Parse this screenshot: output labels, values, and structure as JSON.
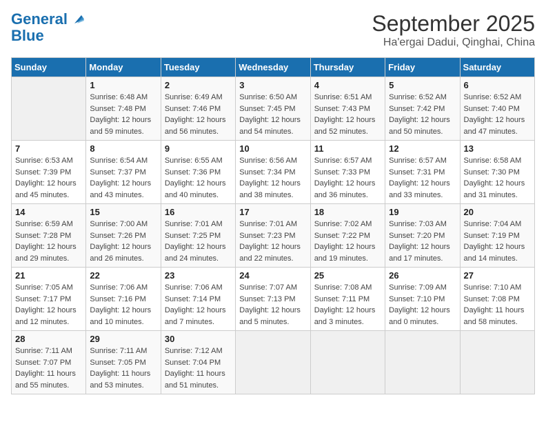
{
  "header": {
    "logo_line1": "General",
    "logo_line2": "Blue",
    "month": "September 2025",
    "location": "Ha'ergai Dadui, Qinghai, China"
  },
  "days_of_week": [
    "Sunday",
    "Monday",
    "Tuesday",
    "Wednesday",
    "Thursday",
    "Friday",
    "Saturday"
  ],
  "weeks": [
    [
      {
        "day": "",
        "info": ""
      },
      {
        "day": "1",
        "info": "Sunrise: 6:48 AM\nSunset: 7:48 PM\nDaylight: 12 hours\nand 59 minutes."
      },
      {
        "day": "2",
        "info": "Sunrise: 6:49 AM\nSunset: 7:46 PM\nDaylight: 12 hours\nand 56 minutes."
      },
      {
        "day": "3",
        "info": "Sunrise: 6:50 AM\nSunset: 7:45 PM\nDaylight: 12 hours\nand 54 minutes."
      },
      {
        "day": "4",
        "info": "Sunrise: 6:51 AM\nSunset: 7:43 PM\nDaylight: 12 hours\nand 52 minutes."
      },
      {
        "day": "5",
        "info": "Sunrise: 6:52 AM\nSunset: 7:42 PM\nDaylight: 12 hours\nand 50 minutes."
      },
      {
        "day": "6",
        "info": "Sunrise: 6:52 AM\nSunset: 7:40 PM\nDaylight: 12 hours\nand 47 minutes."
      }
    ],
    [
      {
        "day": "7",
        "info": "Sunrise: 6:53 AM\nSunset: 7:39 PM\nDaylight: 12 hours\nand 45 minutes."
      },
      {
        "day": "8",
        "info": "Sunrise: 6:54 AM\nSunset: 7:37 PM\nDaylight: 12 hours\nand 43 minutes."
      },
      {
        "day": "9",
        "info": "Sunrise: 6:55 AM\nSunset: 7:36 PM\nDaylight: 12 hours\nand 40 minutes."
      },
      {
        "day": "10",
        "info": "Sunrise: 6:56 AM\nSunset: 7:34 PM\nDaylight: 12 hours\nand 38 minutes."
      },
      {
        "day": "11",
        "info": "Sunrise: 6:57 AM\nSunset: 7:33 PM\nDaylight: 12 hours\nand 36 minutes."
      },
      {
        "day": "12",
        "info": "Sunrise: 6:57 AM\nSunset: 7:31 PM\nDaylight: 12 hours\nand 33 minutes."
      },
      {
        "day": "13",
        "info": "Sunrise: 6:58 AM\nSunset: 7:30 PM\nDaylight: 12 hours\nand 31 minutes."
      }
    ],
    [
      {
        "day": "14",
        "info": "Sunrise: 6:59 AM\nSunset: 7:28 PM\nDaylight: 12 hours\nand 29 minutes."
      },
      {
        "day": "15",
        "info": "Sunrise: 7:00 AM\nSunset: 7:26 PM\nDaylight: 12 hours\nand 26 minutes."
      },
      {
        "day": "16",
        "info": "Sunrise: 7:01 AM\nSunset: 7:25 PM\nDaylight: 12 hours\nand 24 minutes."
      },
      {
        "day": "17",
        "info": "Sunrise: 7:01 AM\nSunset: 7:23 PM\nDaylight: 12 hours\nand 22 minutes."
      },
      {
        "day": "18",
        "info": "Sunrise: 7:02 AM\nSunset: 7:22 PM\nDaylight: 12 hours\nand 19 minutes."
      },
      {
        "day": "19",
        "info": "Sunrise: 7:03 AM\nSunset: 7:20 PM\nDaylight: 12 hours\nand 17 minutes."
      },
      {
        "day": "20",
        "info": "Sunrise: 7:04 AM\nSunset: 7:19 PM\nDaylight: 12 hours\nand 14 minutes."
      }
    ],
    [
      {
        "day": "21",
        "info": "Sunrise: 7:05 AM\nSunset: 7:17 PM\nDaylight: 12 hours\nand 12 minutes."
      },
      {
        "day": "22",
        "info": "Sunrise: 7:06 AM\nSunset: 7:16 PM\nDaylight: 12 hours\nand 10 minutes."
      },
      {
        "day": "23",
        "info": "Sunrise: 7:06 AM\nSunset: 7:14 PM\nDaylight: 12 hours\nand 7 minutes."
      },
      {
        "day": "24",
        "info": "Sunrise: 7:07 AM\nSunset: 7:13 PM\nDaylight: 12 hours\nand 5 minutes."
      },
      {
        "day": "25",
        "info": "Sunrise: 7:08 AM\nSunset: 7:11 PM\nDaylight: 12 hours\nand 3 minutes."
      },
      {
        "day": "26",
        "info": "Sunrise: 7:09 AM\nSunset: 7:10 PM\nDaylight: 12 hours\nand 0 minutes."
      },
      {
        "day": "27",
        "info": "Sunrise: 7:10 AM\nSunset: 7:08 PM\nDaylight: 11 hours\nand 58 minutes."
      }
    ],
    [
      {
        "day": "28",
        "info": "Sunrise: 7:11 AM\nSunset: 7:07 PM\nDaylight: 11 hours\nand 55 minutes."
      },
      {
        "day": "29",
        "info": "Sunrise: 7:11 AM\nSunset: 7:05 PM\nDaylight: 11 hours\nand 53 minutes."
      },
      {
        "day": "30",
        "info": "Sunrise: 7:12 AM\nSunset: 7:04 PM\nDaylight: 11 hours\nand 51 minutes."
      },
      {
        "day": "",
        "info": ""
      },
      {
        "day": "",
        "info": ""
      },
      {
        "day": "",
        "info": ""
      },
      {
        "day": "",
        "info": ""
      }
    ]
  ]
}
